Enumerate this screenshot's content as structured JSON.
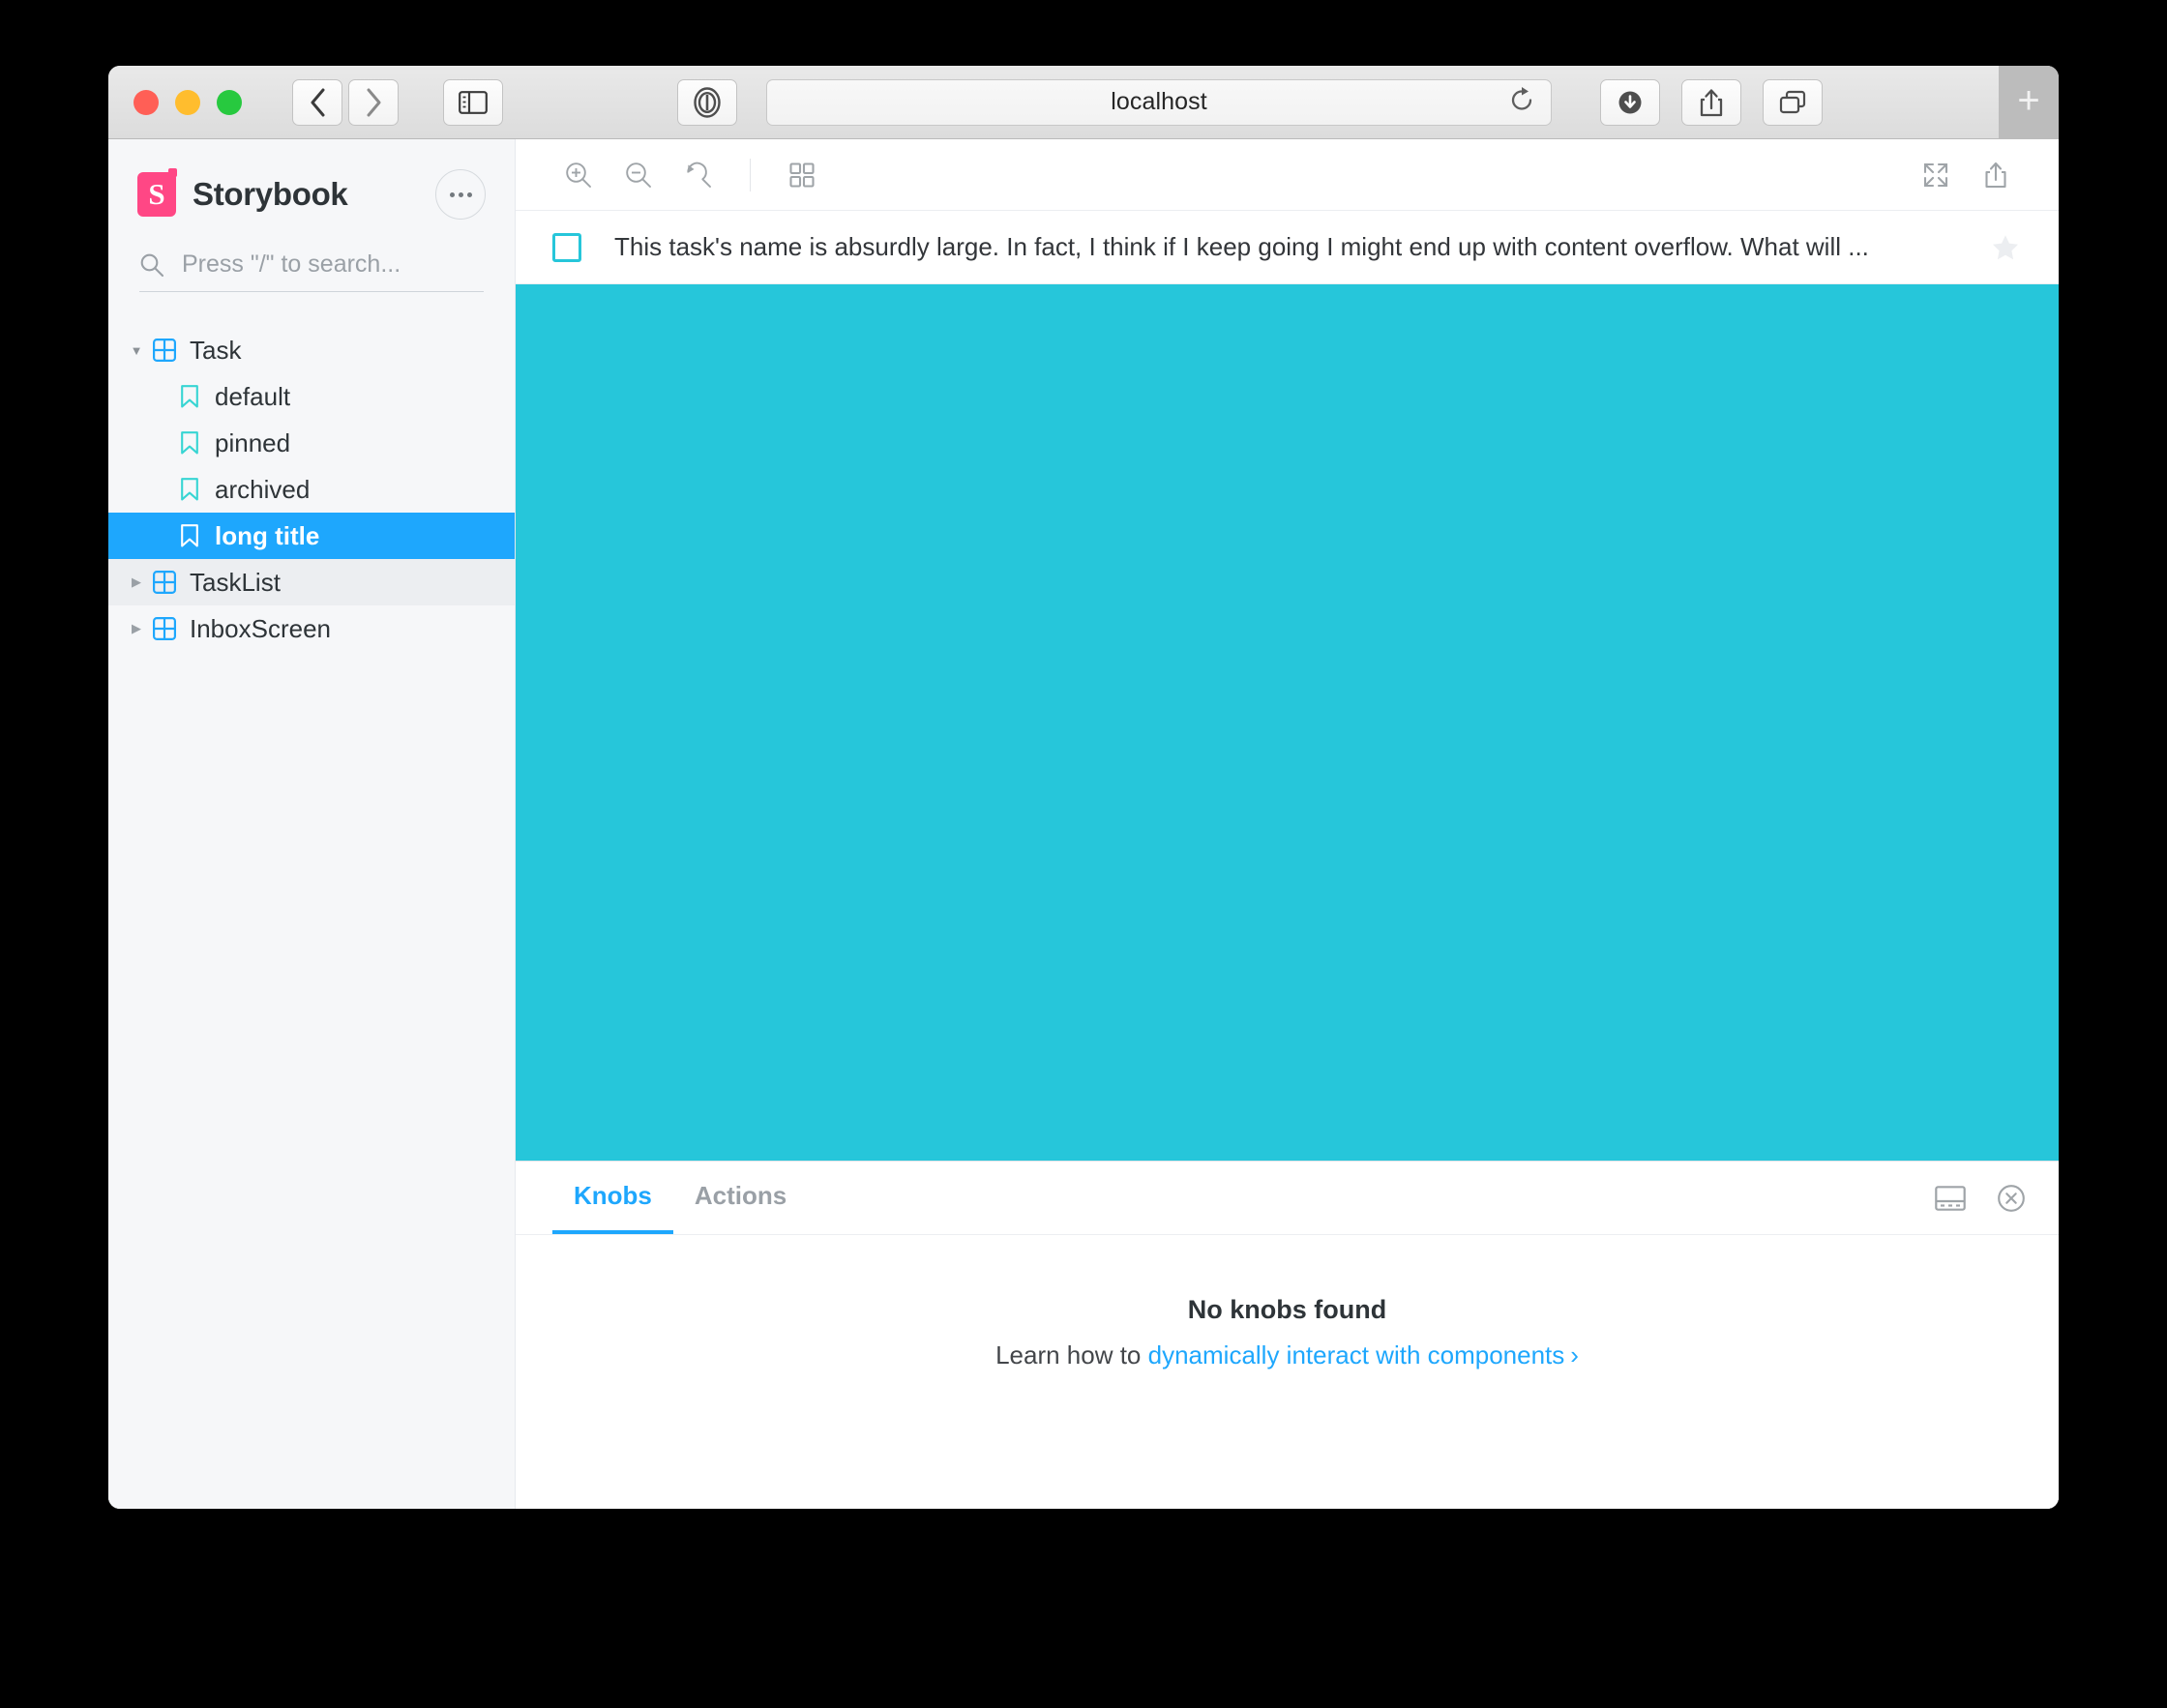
{
  "browser": {
    "url": "localhost",
    "traffic_lights": [
      "close-red",
      "minimize-yellow",
      "maximize-green"
    ],
    "back_label": "‹",
    "forward_label": "›",
    "sidebar_toggle_name": "sidebar-toggle-icon",
    "password_manager_name": "1password-icon",
    "reload_name": "reload-icon",
    "downloads_name": "downloads-icon",
    "share_name": "share-icon",
    "tab_overview_name": "tab-overview-icon",
    "new_tab_label": "+"
  },
  "sidebar": {
    "brand_title": "Storybook",
    "logo_letter": "S",
    "menu_button_name": "more-options-button",
    "search": {
      "placeholder": "Press \"/\" to search...",
      "value": ""
    },
    "tree": [
      {
        "label": "Task",
        "type": "component",
        "expanded": true,
        "selected": false,
        "hovered": false
      },
      {
        "label": "default",
        "type": "story",
        "expanded": false,
        "selected": false,
        "hovered": false
      },
      {
        "label": "pinned",
        "type": "story",
        "expanded": false,
        "selected": false,
        "hovered": false
      },
      {
        "label": "archived",
        "type": "story",
        "expanded": false,
        "selected": false,
        "hovered": false
      },
      {
        "label": "long title",
        "type": "story",
        "expanded": false,
        "selected": true,
        "hovered": false
      },
      {
        "label": "TaskList",
        "type": "component",
        "expanded": false,
        "selected": false,
        "hovered": true
      },
      {
        "label": "InboxScreen",
        "type": "component",
        "expanded": false,
        "selected": false,
        "hovered": false
      }
    ]
  },
  "preview_toolbar": {
    "zoom_in_name": "zoom-in-icon",
    "zoom_out_name": "zoom-out-icon",
    "zoom_reset_name": "zoom-reset-icon",
    "grid_name": "grid-background-icon",
    "fullscreen_name": "fullscreen-icon",
    "open_external_name": "open-in-new-tab-icon"
  },
  "story": {
    "task_title": "This task's name is absurdly large. In fact, I think if I keep going I might end up with content overflow. What will ...",
    "checkbox_checked": false,
    "pinned": false,
    "canvas_color": "#26c6da",
    "checkbox_color": "#26c6da",
    "star_color": "#eceef1"
  },
  "addons_panel": {
    "tabs": [
      {
        "label": "Knobs",
        "active": true
      },
      {
        "label": "Actions",
        "active": false
      }
    ],
    "dock_toggle_name": "panel-position-bottom-icon",
    "close_name": "close-panel-icon",
    "empty_title": "No knobs found",
    "empty_prefix": "Learn how to",
    "empty_link": "dynamically interact with components",
    "empty_chevron": "›"
  },
  "colors": {
    "accent_blue": "#1ea7fd",
    "brand_pink": "#ff4785",
    "story_icon_teal": "#37d5d3",
    "canvas_cyan": "#26c6da",
    "sidebar_bg": "#f6f7f9"
  }
}
